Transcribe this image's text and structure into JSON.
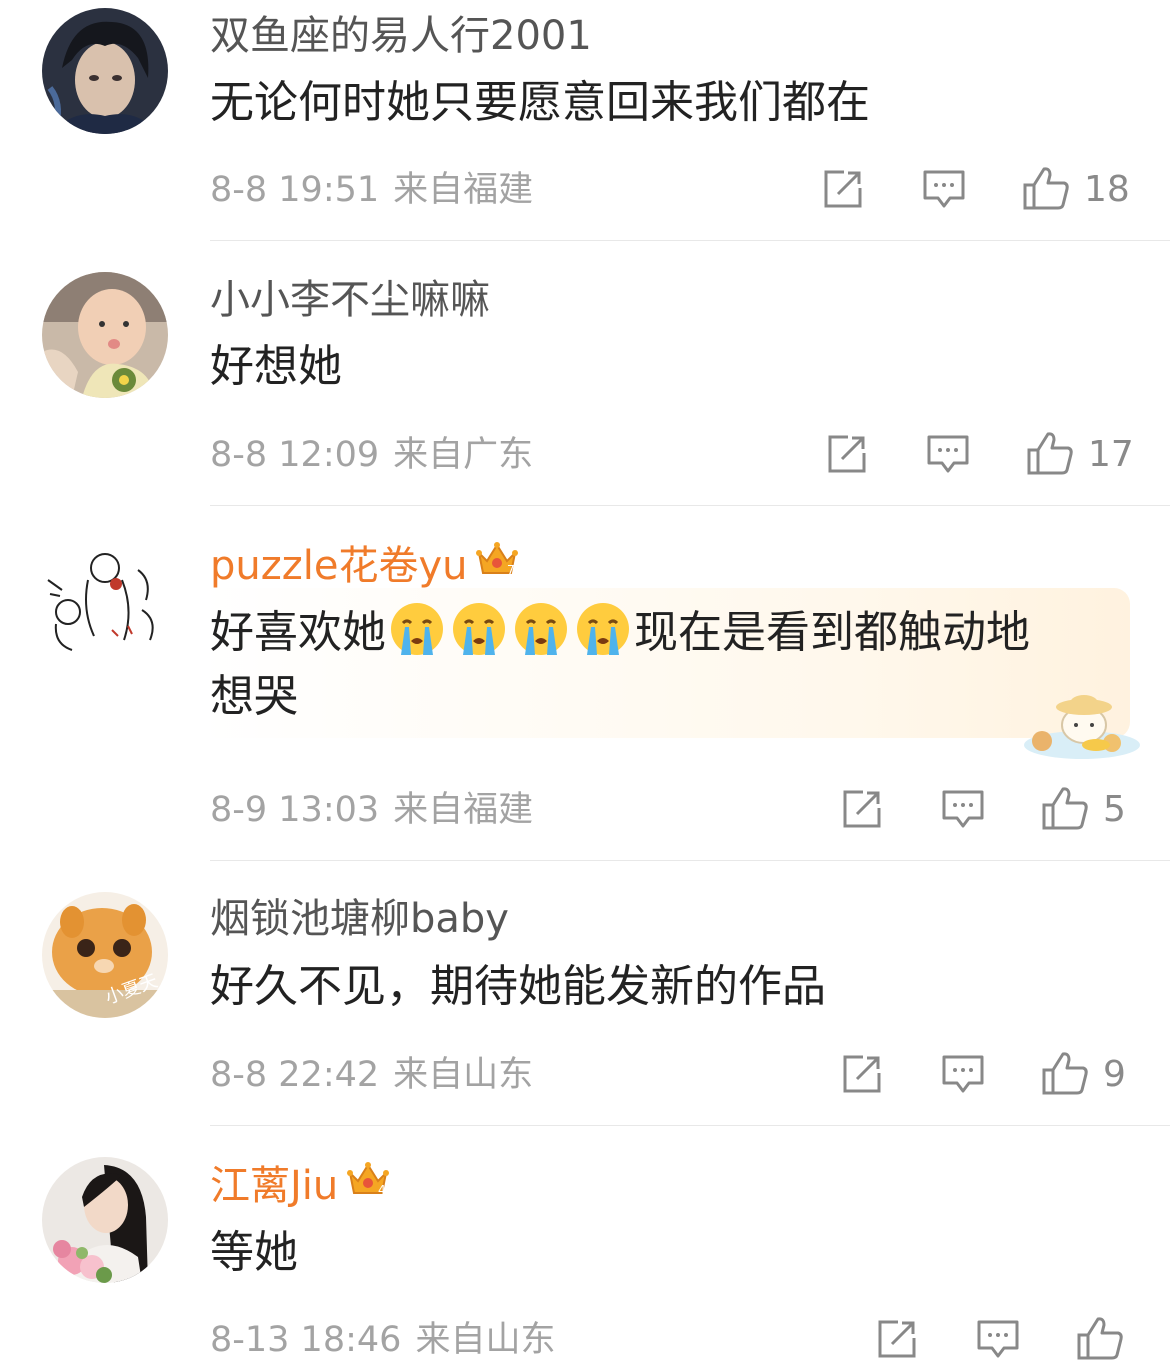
{
  "comments": [
    {
      "username": "双鱼座的易人行2001",
      "vip": false,
      "text": "无论何时她只要愿意回来我们都在",
      "time": "8-8 19:51",
      "location": "来自福建",
      "likes": "18"
    },
    {
      "username": "小小李不尘嘛嘛",
      "vip": false,
      "text": "好想她",
      "time": "8-8 12:09",
      "location": "来自广东",
      "likes": "17"
    },
    {
      "username": "puzzle花卷yu",
      "vip": true,
      "crown_level": "7",
      "text_line1_a": "好喜欢她",
      "text_line1_b": "现在是看到都触动地",
      "text_line2": "想哭",
      "emoji": "crying-face",
      "time": "8-9 13:03",
      "location": "来自福建",
      "likes": "5"
    },
    {
      "username": "烟锁池塘柳baby",
      "vip": false,
      "avatar_text": "小夏天",
      "text": "好久不见，期待她能发新的作品",
      "time": "8-8 22:42",
      "location": "来自山东",
      "likes": "9"
    },
    {
      "username": "江蓠Jiu",
      "vip": true,
      "crown_level": "4",
      "text": "等她",
      "time": "8-13 18:46",
      "location": "来自山东",
      "likes": ""
    }
  ],
  "icons": {
    "share": "share-icon",
    "comment": "comment-icon",
    "like": "like-icon"
  },
  "colors": {
    "vip_name": "#f07b2a",
    "username": "#555555",
    "text": "#222222",
    "meta": "#a3a3a3"
  }
}
